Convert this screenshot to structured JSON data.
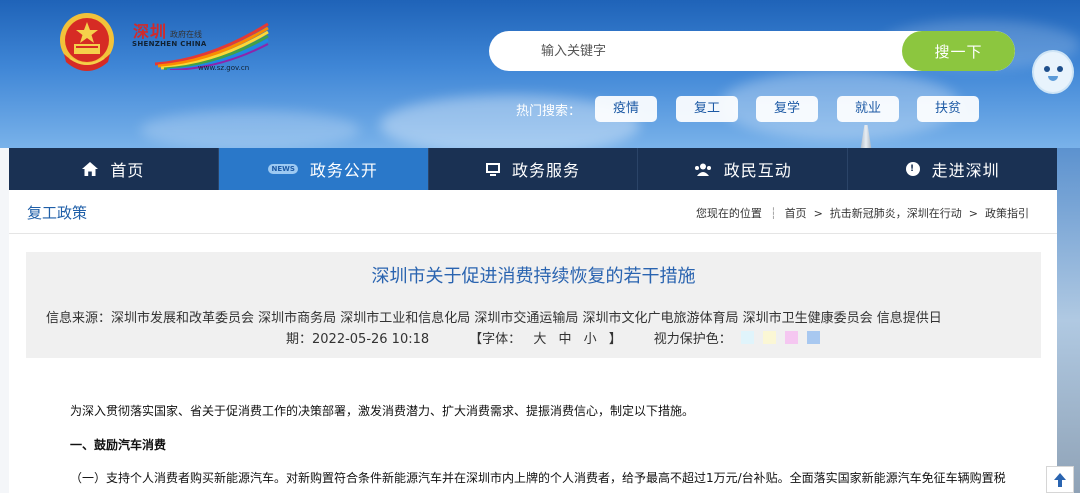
{
  "site": {
    "logo_cn": "深圳",
    "logo_cn_small": "政府在线",
    "logo_en": "SHENZHEN CHINA",
    "logo_url": "www.sz.gov.cn"
  },
  "search": {
    "placeholder": "输入关键字",
    "button_label": "搜一下"
  },
  "hot_search": {
    "label": "热门搜索：",
    "tags": [
      "疫情",
      "复工",
      "复学",
      "就业",
      "扶贫"
    ]
  },
  "nav": {
    "items": [
      {
        "label": "首页",
        "icon": "home-icon"
      },
      {
        "label": "政务公开",
        "icon": "news-icon",
        "icon_text": "NEWS",
        "active": true
      },
      {
        "label": "政务服务",
        "icon": "monitor-icon"
      },
      {
        "label": "政民互动",
        "icon": "people-icon"
      },
      {
        "label": "走进深圳",
        "icon": "chat-icon"
      }
    ]
  },
  "section": {
    "title": "复工政策"
  },
  "breadcrumb": {
    "label": "您现在的位置",
    "items": [
      "首页",
      "抗击新冠肺炎，深圳在行动",
      "政策指引"
    ]
  },
  "article": {
    "title": "深圳市关于促进消费持续恢复的若干措施",
    "source_line": "信息来源：深圳市发展和改革委员会 深圳市商务局 深圳市工业和信息化局 深圳市交通运输局 深圳市文化广电旅游体育局 深圳市卫生健康委员会        信息提供日",
    "date_line": "期：2022-05-26 10:18",
    "font_label": "【字体：",
    "font_sizes": [
      "大",
      "中",
      "小"
    ],
    "font_close": "】",
    "protect_label": "视力保护色：",
    "protect_colors": [
      "#e0f4fb",
      "#fbf7d5",
      "#f5c7f1",
      "#a8c8f0"
    ],
    "paragraphs": [
      "为深入贯彻落实国家、省关于促消费工作的决策部署，激发消费潜力、扩大消费需求、提振消费信心，制定以下措施。",
      "一、鼓励汽车消费",
      "（一）支持个人消费者购买新能源汽车。对新购置符合条件新能源汽车并在深圳市内上牌的个人消费者，给予最高不超过1万元/台补贴。全面落实国家新能源汽车免征车辆购置税"
    ]
  },
  "colors": {
    "nav_bg": "#1a3153",
    "nav_active": "#2a78c9",
    "search_button": "#8cc63f",
    "title_blue": "#2a64b0"
  }
}
